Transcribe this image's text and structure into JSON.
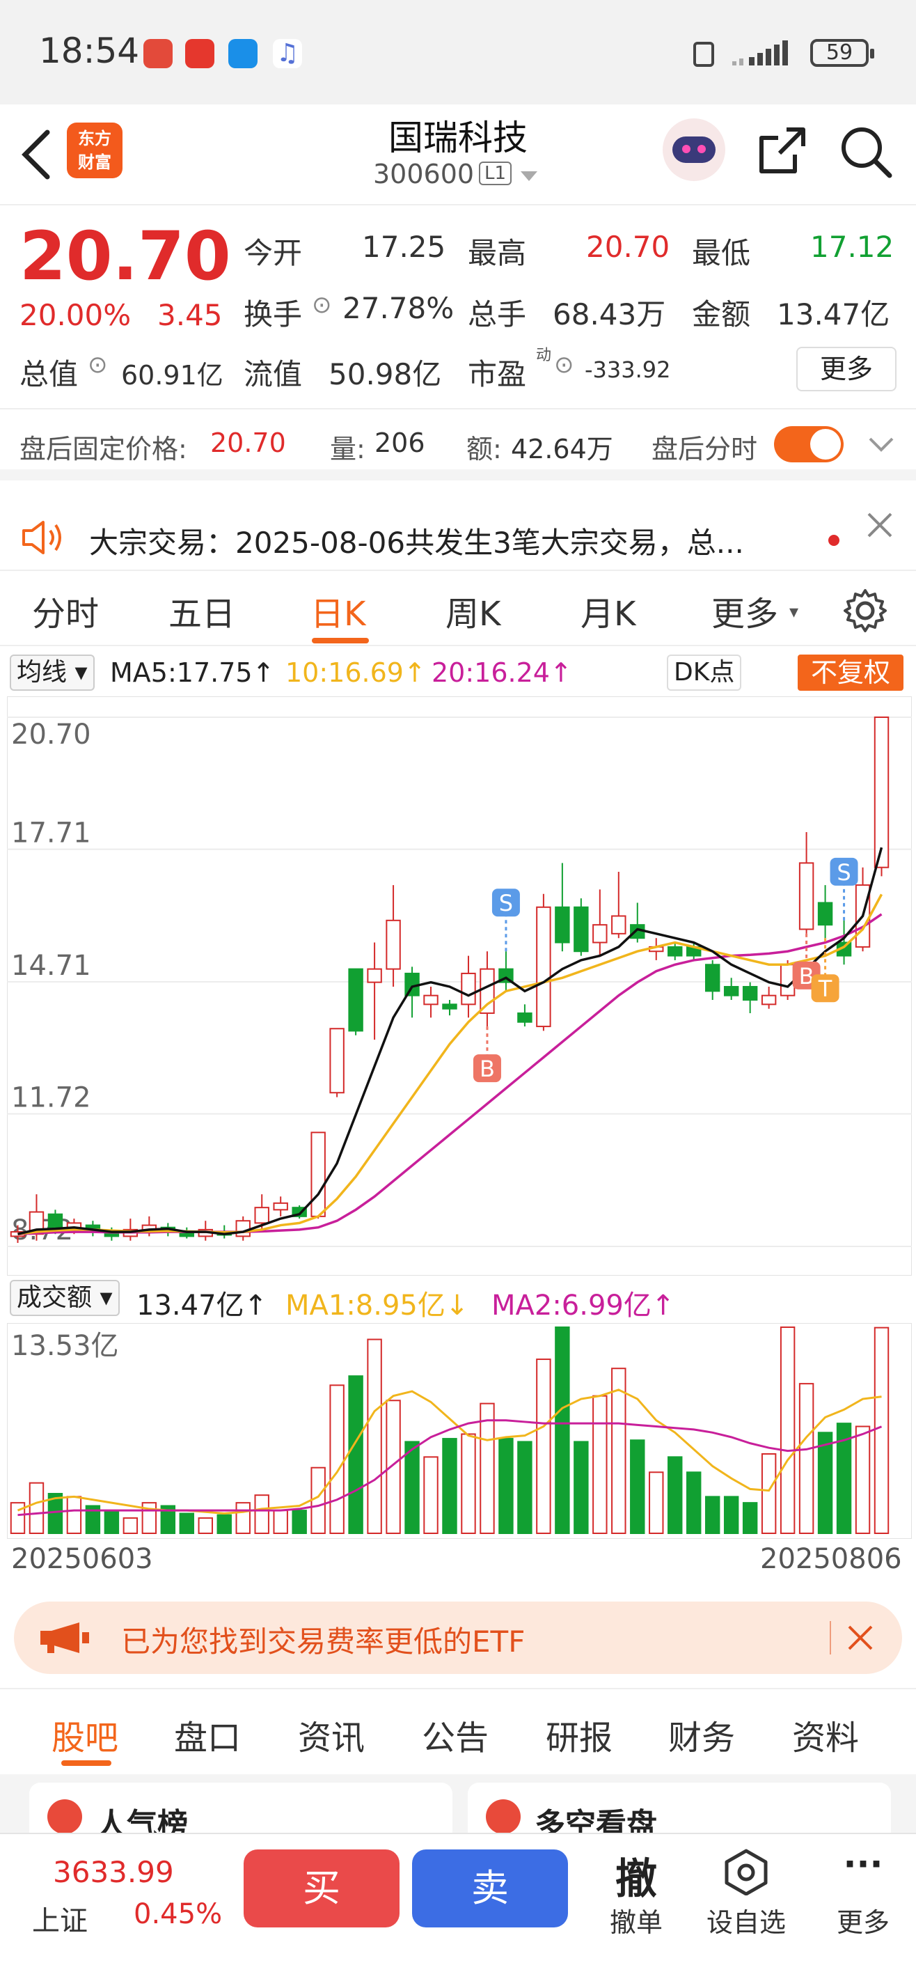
{
  "status": {
    "time": "18:54",
    "battery": "59"
  },
  "header": {
    "logo_line1": "东方",
    "logo_line2": "财富",
    "title": "国瑞科技",
    "code": "300600",
    "level": "L1"
  },
  "quote": {
    "price": "20.70",
    "change_pct": "20.00%",
    "change_amt": "3.45",
    "open_label": "今开",
    "open": "17.25",
    "high_label": "最高",
    "high": "20.70",
    "low_label": "最低",
    "low": "17.12",
    "turnover_label": "换手",
    "turnover": "27.78%",
    "volume_label": "总手",
    "volume": "68.43万",
    "amount_label": "金额",
    "amount": "13.47亿",
    "mktcap_label": "总值",
    "mktcap": "60.91亿",
    "float_label": "流值",
    "float": "50.98亿",
    "pe_label": "市盈",
    "pe_sup": "动",
    "pe": "-333.92",
    "more": "更多"
  },
  "afterhours": {
    "price_label": "盘后固定价格:",
    "price": "20.70",
    "vol_label": "量:",
    "vol": "206",
    "amt_label": "额:",
    "amt": "42.64万",
    "toggle_label": "盘后分时"
  },
  "notice": {
    "text": "大宗交易：2025-08-06共发生3笔大宗交易，总..."
  },
  "tabs": [
    "分时",
    "五日",
    "日K",
    "周K",
    "月K",
    "更多"
  ],
  "ma": {
    "selector": "均线",
    "ma5": "MA5:17.75↑",
    "ma10": "10:16.69↑",
    "ma20": "20:16.24↑",
    "dk": "DK点",
    "adjust": "不复权"
  },
  "vol_panel": {
    "selector": "成交额",
    "val": "13.47亿↑",
    "ma1": "MA1:8.95亿↓",
    "ma2": "MA2:6.99亿↑",
    "top": "13.53亿"
  },
  "chart_data": {
    "type": "candlestick",
    "y_ticks": [
      "20.70",
      "17.71",
      "14.71",
      "11.72",
      "8.72"
    ],
    "ylim": [
      8.72,
      20.7
    ],
    "x_start": "20250603",
    "x_end": "20250806",
    "colors": {
      "up": "#d42a2a",
      "down": "#11a032",
      "ma5": "#111111",
      "ma10": "#f1b51c",
      "ma20": "#c81f9a"
    },
    "markers": [
      {
        "label": "S",
        "index": 26
      },
      {
        "label": "B",
        "index": 25
      },
      {
        "label": "S",
        "index": 44
      },
      {
        "label": "B",
        "index": 42
      },
      {
        "label": "T",
        "index": 43
      }
    ],
    "candles": [
      [
        8.95,
        9.05,
        8.8,
        9.2
      ],
      [
        9.0,
        9.5,
        8.85,
        9.9
      ],
      [
        9.45,
        9.1,
        9.0,
        9.55
      ],
      [
        9.1,
        9.25,
        9.0,
        9.35
      ],
      [
        9.2,
        9.05,
        8.95,
        9.3
      ],
      [
        9.05,
        8.95,
        8.85,
        9.15
      ],
      [
        8.95,
        9.1,
        8.85,
        9.35
      ],
      [
        9.05,
        9.2,
        8.95,
        9.4
      ],
      [
        9.15,
        9.05,
        8.95,
        9.25
      ],
      [
        9.05,
        8.95,
        8.9,
        9.15
      ],
      [
        8.95,
        9.1,
        8.85,
        9.3
      ],
      [
        9.05,
        8.98,
        8.9,
        9.2
      ],
      [
        8.95,
        9.3,
        8.85,
        9.4
      ],
      [
        9.25,
        9.6,
        9.1,
        9.9
      ],
      [
        9.55,
        9.7,
        9.4,
        9.85
      ],
      [
        9.6,
        9.4,
        9.35,
        9.65
      ],
      [
        9.4,
        11.3,
        9.35,
        11.3
      ],
      [
        12.2,
        13.65,
        12.1,
        13.65
      ],
      [
        15.0,
        13.6,
        13.5,
        15.0
      ],
      [
        14.7,
        15.0,
        13.4,
        15.6
      ],
      [
        15.0,
        16.1,
        14.6,
        16.9
      ],
      [
        14.9,
        14.4,
        13.9,
        15.05
      ],
      [
        14.2,
        14.4,
        13.9,
        14.6
      ],
      [
        14.2,
        14.1,
        13.95,
        14.3
      ],
      [
        14.2,
        14.9,
        13.9,
        15.3
      ],
      [
        14.0,
        15.0,
        13.7,
        15.4
      ],
      [
        15.0,
        14.7,
        14.5,
        15.4
      ],
      [
        14.0,
        13.8,
        13.7,
        14.2
      ],
      [
        13.7,
        16.4,
        13.6,
        16.7
      ],
      [
        16.4,
        15.6,
        15.4,
        17.4
      ],
      [
        16.4,
        15.4,
        15.3,
        16.6
      ],
      [
        15.6,
        16.0,
        15.3,
        16.8
      ],
      [
        15.8,
        16.2,
        15.7,
        17.2
      ],
      [
        16.0,
        15.7,
        15.6,
        16.5
      ],
      [
        15.4,
        15.5,
        15.2,
        15.7
      ],
      [
        15.5,
        15.3,
        15.2,
        15.6
      ],
      [
        15.5,
        15.3,
        15.2,
        15.6
      ],
      [
        15.1,
        14.5,
        14.3,
        15.2
      ],
      [
        14.6,
        14.4,
        14.3,
        14.8
      ],
      [
        14.6,
        14.3,
        14.0,
        14.7
      ],
      [
        14.2,
        14.4,
        14.1,
        14.6
      ],
      [
        14.4,
        15.1,
        14.3,
        15.2
      ],
      [
        15.9,
        17.4,
        15.8,
        18.1
      ],
      [
        16.5,
        16.0,
        15.7,
        16.9
      ],
      [
        15.6,
        15.3,
        15.1,
        16.1
      ],
      [
        15.5,
        16.9,
        15.4,
        17.3
      ],
      [
        17.3,
        20.7,
        17.1,
        20.7
      ]
    ],
    "ma5": [
      9.0,
      9.1,
      9.12,
      9.15,
      9.1,
      9.05,
      9.05,
      9.1,
      9.12,
      9.05,
      9.05,
      9.0,
      9.05,
      9.2,
      9.35,
      9.45,
      9.9,
      10.6,
      11.7,
      12.8,
      13.9,
      14.6,
      14.7,
      14.6,
      14.4,
      14.6,
      14.8,
      14.5,
      14.7,
      15.0,
      15.2,
      15.3,
      15.5,
      15.9,
      15.8,
      15.7,
      15.6,
      15.4,
      15.1,
      14.9,
      14.7,
      14.6,
      15.0,
      15.4,
      15.7,
      16.2,
      17.75
    ],
    "ma10": [
      9.0,
      9.05,
      9.08,
      9.1,
      9.1,
      9.08,
      9.06,
      9.06,
      9.07,
      9.06,
      9.05,
      9.04,
      9.05,
      9.1,
      9.2,
      9.25,
      9.4,
      9.8,
      10.3,
      10.9,
      11.5,
      12.1,
      12.7,
      13.3,
      13.8,
      14.2,
      14.5,
      14.6,
      14.7,
      14.8,
      14.95,
      15.1,
      15.25,
      15.4,
      15.5,
      15.6,
      15.5,
      15.4,
      15.3,
      15.2,
      15.1,
      15.1,
      15.2,
      15.3,
      15.5,
      15.9,
      16.69
    ],
    "ma20": [
      9.0,
      9.02,
      9.04,
      9.05,
      9.05,
      9.04,
      9.04,
      9.04,
      9.05,
      9.05,
      9.05,
      9.05,
      9.05,
      9.06,
      9.08,
      9.1,
      9.15,
      9.3,
      9.55,
      9.85,
      10.2,
      10.55,
      10.9,
      11.25,
      11.6,
      11.95,
      12.3,
      12.65,
      13.0,
      13.35,
      13.7,
      14.05,
      14.4,
      14.7,
      14.95,
      15.1,
      15.2,
      15.25,
      15.3,
      15.32,
      15.35,
      15.4,
      15.5,
      15.6,
      15.75,
      15.95,
      16.24
    ],
    "volume": [
      2.0,
      3.3,
      2.6,
      2.4,
      1.8,
      1.4,
      1.0,
      2.0,
      1.8,
      1.3,
      1.0,
      1.2,
      2.0,
      2.5,
      1.5,
      1.5,
      4.3,
      9.7,
      10.3,
      12.7,
      8.7,
      6.0,
      5.0,
      6.2,
      6.5,
      8.5,
      6.2,
      6.0,
      11.4,
      13.5,
      6.0,
      9.0,
      10.8,
      6.1,
      4.0,
      5.0,
      4.0,
      2.4,
      2.4,
      2.0,
      5.2,
      13.5,
      9.8,
      6.6,
      7.2,
      7.0,
      13.47
    ],
    "vol_ma1": [
      1.5,
      2.0,
      2.3,
      2.4,
      2.2,
      2.0,
      1.8,
      1.6,
      1.5,
      1.5,
      1.4,
      1.3,
      1.4,
      1.6,
      1.7,
      1.8,
      2.4,
      4.0,
      6.0,
      8.0,
      9.0,
      9.3,
      8.6,
      7.5,
      6.4,
      6.1,
      6.3,
      6.4,
      7.0,
      8.2,
      8.8,
      9.0,
      9.4,
      8.8,
      7.4,
      6.6,
      5.5,
      4.4,
      3.6,
      2.9,
      2.8,
      4.8,
      6.3,
      7.6,
      8.1,
      8.8,
      8.95
    ],
    "vol_ma2": [
      1.2,
      1.3,
      1.4,
      1.5,
      1.5,
      1.5,
      1.5,
      1.5,
      1.5,
      1.5,
      1.5,
      1.5,
      1.5,
      1.5,
      1.5,
      1.6,
      1.8,
      2.2,
      2.8,
      3.5,
      4.5,
      5.5,
      6.3,
      6.8,
      7.2,
      7.4,
      7.4,
      7.3,
      7.2,
      7.2,
      7.2,
      7.2,
      7.2,
      7.1,
      7.0,
      6.9,
      6.8,
      6.6,
      6.3,
      5.9,
      5.6,
      5.4,
      5.5,
      5.8,
      6.1,
      6.5,
      6.99
    ]
  },
  "promo": {
    "text": "已为您找到交易费率更低的ETF"
  },
  "subtabs": [
    "股吧",
    "盘口",
    "资讯",
    "公告",
    "研报",
    "财务",
    "资料"
  ],
  "cards": {
    "left": "人气榜",
    "right": "多空看盘"
  },
  "bottom": {
    "index_value": "3633.99",
    "index_name": "上证",
    "index_change": "0.45%",
    "buy": "买",
    "sell": "卖",
    "cancel_big": "撤",
    "cancel": "撤单",
    "watch": "设自选",
    "more": "更多"
  }
}
